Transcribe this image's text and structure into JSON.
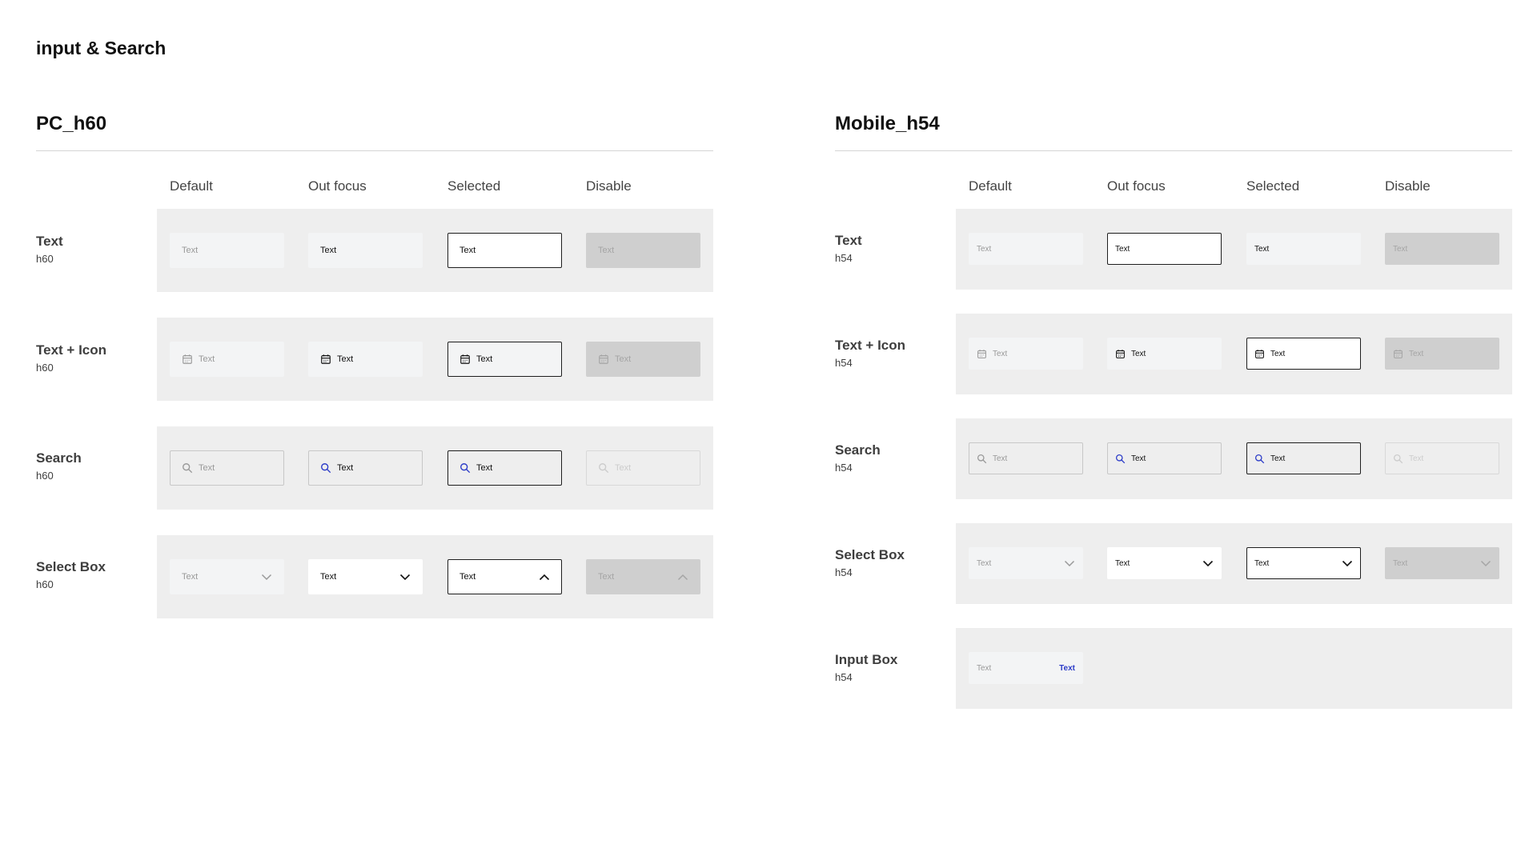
{
  "page_title": "input & Search",
  "icon_colors": {
    "default": "#999999",
    "active": "#111111",
    "search_active": "#2c3cc8",
    "disabled": "#a5a5a5",
    "search_disabled": "#cccccc"
  },
  "pc": {
    "title": "PC_h60",
    "columns": [
      "Default",
      "Out focus",
      "Selected",
      "Disable"
    ],
    "rows": [
      {
        "name": "Text",
        "size": "h60",
        "cells": [
          "Text",
          "Text",
          "Text",
          "Text"
        ]
      },
      {
        "name": "Text + Icon",
        "size": "h60",
        "cells": [
          "Text",
          "Text",
          "Text",
          "Text"
        ],
        "icon": "calendar-icon"
      },
      {
        "name": "Search",
        "size": "h60",
        "cells": [
          "Text",
          "Text",
          "Text",
          "Text"
        ],
        "icon": "search-icon"
      },
      {
        "name": "Select Box",
        "size": "h60",
        "cells": [
          "Text",
          "Text",
          "Text",
          "Text"
        ],
        "chevrons": [
          "chevron-down-icon",
          "chevron-down-icon",
          "chevron-up-icon",
          "chevron-up-icon"
        ]
      }
    ]
  },
  "mobile": {
    "title": "Mobile_h54",
    "columns": [
      "Default",
      "Out focus",
      "Selected",
      "Disable"
    ],
    "rows": [
      {
        "name": "Text",
        "size": "h54",
        "cells": [
          "Text",
          "Text",
          "Text",
          "Text"
        ]
      },
      {
        "name": "Text + Icon",
        "size": "h54",
        "cells": [
          "Text",
          "Text",
          "Text",
          "Text"
        ],
        "icon": "calendar-icon"
      },
      {
        "name": "Search",
        "size": "h54",
        "cells": [
          "Text",
          "Text",
          "Text",
          "Text"
        ],
        "icon": "search-icon"
      },
      {
        "name": "Select Box",
        "size": "h54",
        "cells": [
          "Text",
          "Text",
          "Text",
          "Text"
        ],
        "chevrons": [
          "chevron-down-icon",
          "chevron-down-icon",
          "chevron-down-icon",
          "chevron-down-icon"
        ]
      },
      {
        "name": "Input Box",
        "size": "h54",
        "placeholder": "Text",
        "action": "Text"
      }
    ]
  }
}
